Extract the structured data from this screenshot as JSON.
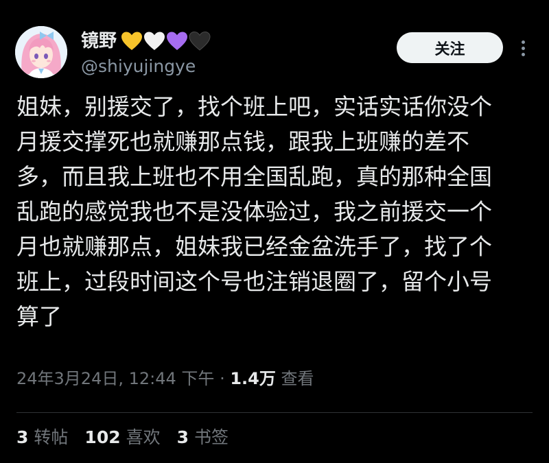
{
  "author": {
    "display_name": "镜野",
    "name_hearts": [
      {
        "icon": "yellow-heart-icon",
        "color": "#f7c42b"
      },
      {
        "icon": "white-heart-icon",
        "color": "#f2f2f2"
      },
      {
        "icon": "purple-heart-icon",
        "color": "#a66cf0"
      },
      {
        "icon": "black-heart-icon",
        "color": "#2b2b2b"
      }
    ],
    "handle": "@shiyujingye",
    "avatar_icon": "anime-girl-avatar"
  },
  "actions": {
    "follow_label": "关注",
    "more_icon": "more-vertical-icon"
  },
  "tweet": {
    "text": "姐妹，别援交了，找个班上吧，实话实话你没个\n月援交撑死也就赚那点钱，跟我上班赚的差不\n多，而且我上班也不用全国乱跑，真的那种全国\n乱跑的感觉我也不是没体验过，我之前援交一个\n月也就赚那点，姐妹我已经金盆洗手了，找了个\n班上，过段时间这个号也注销退圈了，留个小号\n算了"
  },
  "meta": {
    "date": "24年3月24日",
    "time": "12:44 下午",
    "separator": "·",
    "views_count": "1.4万",
    "views_label": "查看"
  },
  "stats": {
    "reposts_count": "3",
    "reposts_label": "转帖",
    "likes_count": "102",
    "likes_label": "喜欢",
    "bookmarks_count": "3",
    "bookmarks_label": "书签"
  },
  "colors": {
    "background": "#000000",
    "text_primary": "#e7e9ea",
    "text_secondary": "#71767b",
    "divider": "#2f3336",
    "follow_button_bg": "#eff3f4"
  }
}
